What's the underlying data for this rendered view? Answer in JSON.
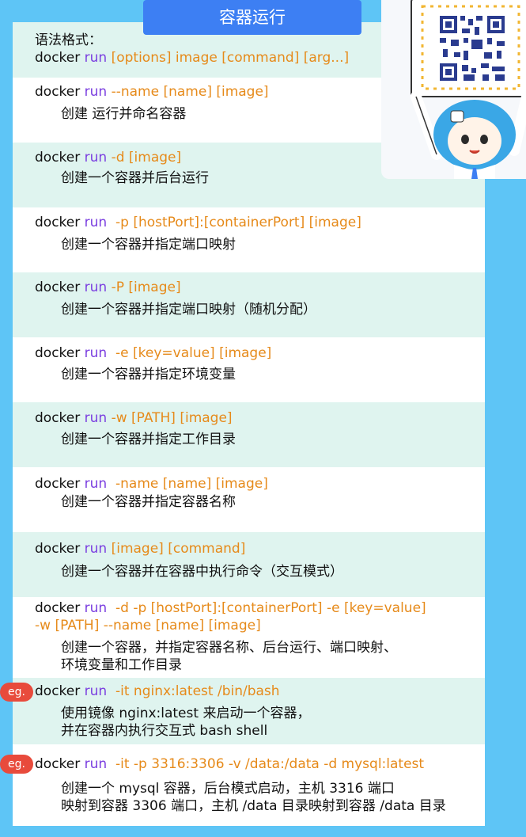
{
  "title": "容器运行",
  "syntax": {
    "heading": "语法格式：",
    "docker": "docker",
    "run": "run",
    "rest": " [options] image [command] [arg...]"
  },
  "items": [
    {
      "docker": "docker",
      "run": "run",
      "opt": " --name [name] [image]",
      "desc": "创建 运行并命名容器"
    },
    {
      "docker": "docker",
      "run": "run",
      "opt": " -d [image]",
      "desc": "创建一个容器并后台运行"
    },
    {
      "docker": "docker",
      "run": "run",
      "opt": "  -p [hostPort]:[containerPort] [image]",
      "desc": "创建一个容器并指定端口映射"
    },
    {
      "docker": "docker",
      "run": "run",
      "opt": " -P [image]",
      "desc": "创建一个容器并指定端口映射（随机分配）"
    },
    {
      "docker": "docker",
      "run": "run",
      "opt": "  -e [key=value] [image]",
      "desc": "创建一个容器并指定环境变量"
    },
    {
      "docker": "docker",
      "run": "run",
      "opt": " -w [PATH] [image]",
      "desc": "创建一个容器并指定工作目录"
    },
    {
      "docker": "docker",
      "run": "run",
      "opt": "  -name [name] [image]",
      "desc": "创建一个容器并指定容器名称"
    },
    {
      "docker": "docker",
      "run": "run",
      "opt": " [image] [command]",
      "desc": "创建一个容器并在容器中执行命令（交互模式）"
    }
  ],
  "combined": {
    "docker": "docker",
    "run": "run",
    "opt1": "  -d -p [hostPort]:[containerPort] -e [key=value]",
    "opt2": "-w [PATH] --name [name] [image]",
    "desc1": "创建一个容器，并指定容器名称、后台运行、端口映射、",
    "desc2": "环境变量和工作目录"
  },
  "examples": [
    {
      "badge": "eg.",
      "docker": "docker",
      "run": "run",
      "opt": "  -it nginx:latest /bin/bash",
      "desc1": "使用镜像 nginx:latest 来启动一个容器，",
      "desc2": "并在容器内执行交互式 bash shell"
    },
    {
      "badge": "eg.",
      "docker": "docker",
      "run": "run",
      "opt": "  -it -p 3316:3306 -v /data:/data -d mysql:latest",
      "desc1": "创建一个 mysql 容器，后台模式启动，主机 3316 端口",
      "desc2": "映射到容器 3306 端口，主机 /data 目录映射到容器 /data 目录"
    }
  ],
  "colors": {
    "accent": "#3d7ff3",
    "run": "#7b3fe0",
    "option": "#e68a1a",
    "badge": "#e84b3c",
    "mint": "#dff4ef",
    "background": "#5ec5f6"
  }
}
